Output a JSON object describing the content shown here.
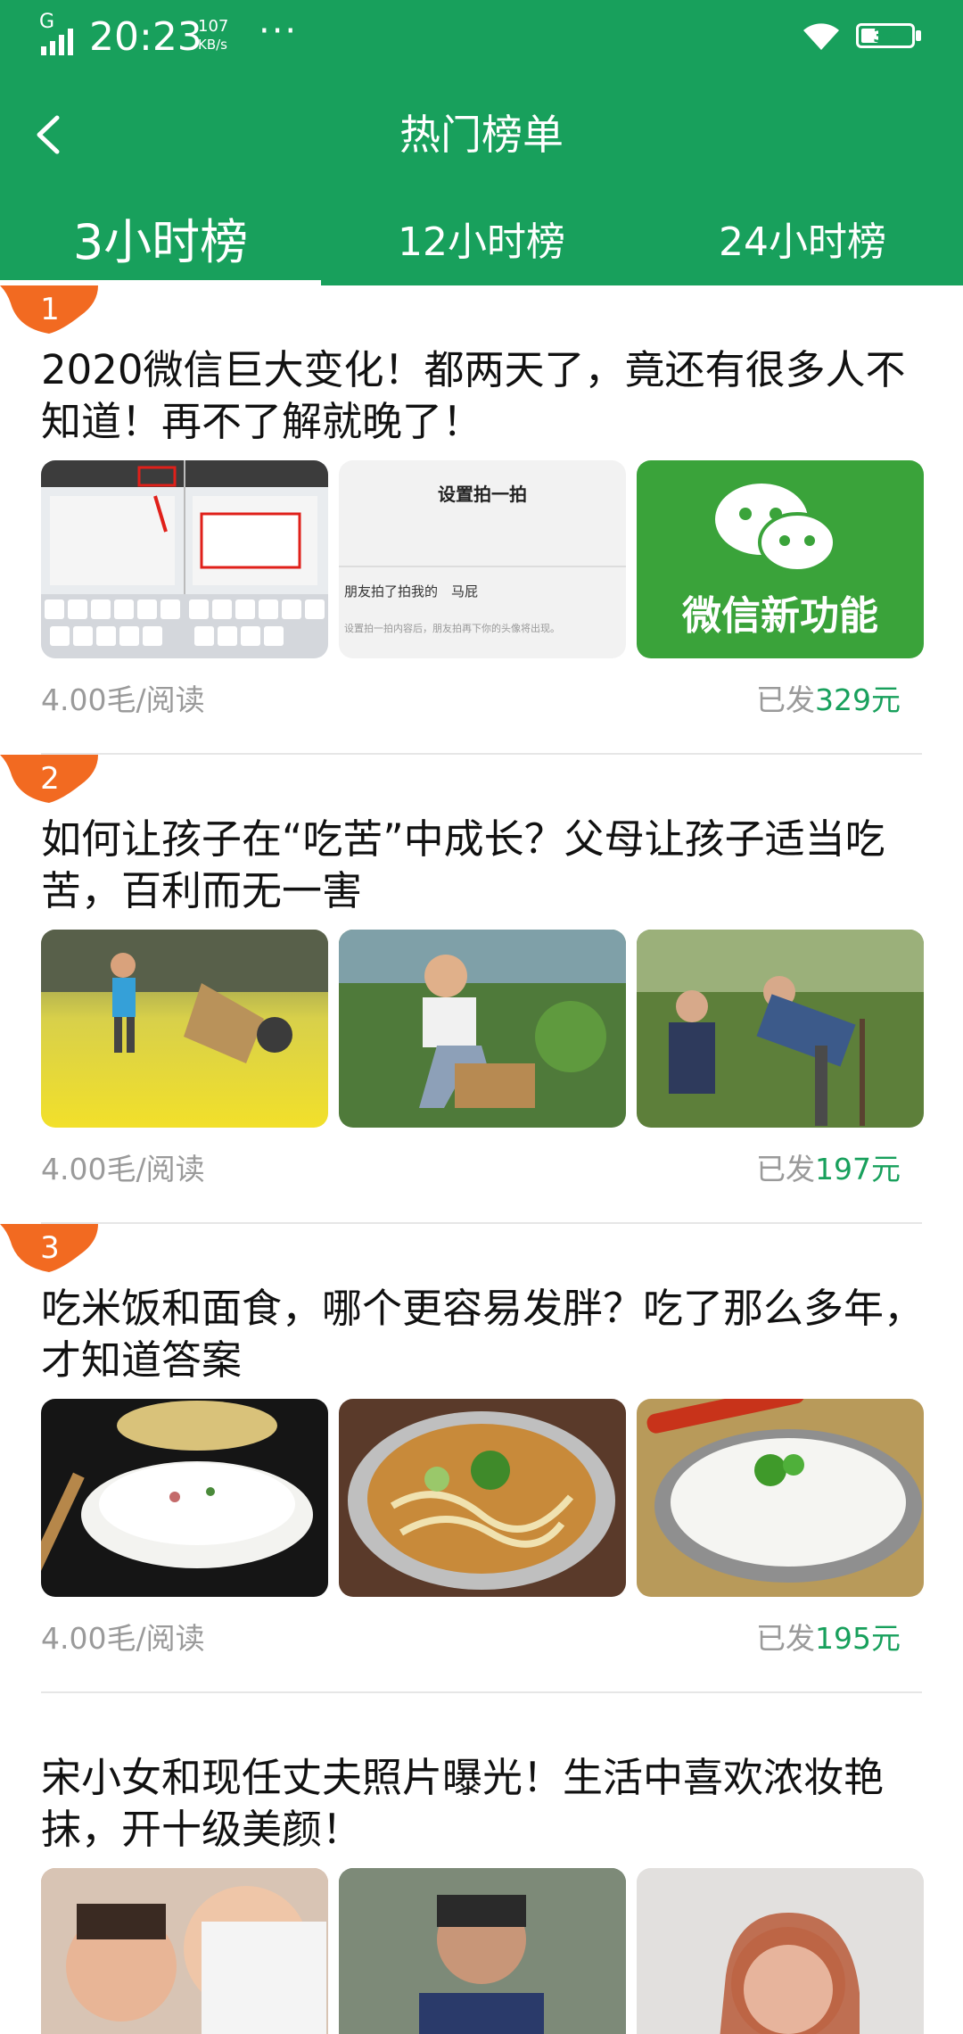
{
  "status_bar": {
    "signal_label": "G",
    "time": "20:23",
    "speed_value": "107",
    "speed_unit": "KB/s",
    "more": "···",
    "battery": "36",
    "battery_level": 0.36
  },
  "header": {
    "title": "热门榜单"
  },
  "tabs": [
    {
      "label": "3小时榜",
      "active": true
    },
    {
      "label": "12小时榜",
      "active": false
    },
    {
      "label": "24小时榜",
      "active": false
    }
  ],
  "articles": [
    {
      "rank": "1",
      "title": "2020微信巨大变化！都两天了，竟还有很多人不知道！再不了解就晚了！",
      "price": "4.00毛/阅读",
      "paid_prefix": "已发",
      "paid_amount": "329元",
      "thumbs": [
        {
          "icon": "keyboard-screenshot-image",
          "caption": ""
        },
        {
          "icon": "settings-screenshot-image",
          "caption": "设置拍一拍",
          "lines": [
            "朋友拍了拍我的　马屁",
            "设置拍一拍内容后，朋友拍再下你的头像将出现。"
          ]
        },
        {
          "icon": "wechat-logo-image",
          "caption": "微信新功能"
        }
      ]
    },
    {
      "rank": "2",
      "title": "如何让孩子在“吃苦”中成长？父母让孩子适当吃苦，百利而无一害",
      "price": "4.00毛/阅读",
      "paid_prefix": "已发",
      "paid_amount": "197元",
      "thumbs": [
        {
          "icon": "child-field-image"
        },
        {
          "icon": "boy-sitting-image"
        },
        {
          "icon": "farmers-image"
        }
      ]
    },
    {
      "rank": "3",
      "title": "吃米饭和面食，哪个更容易发胖？吃了那么多年，才知道答案",
      "price": "4.00毛/阅读",
      "paid_prefix": "已发",
      "paid_amount": "195元",
      "thumbs": [
        {
          "icon": "rice-bowl-image"
        },
        {
          "icon": "noodle-bowl-image"
        },
        {
          "icon": "rice-plate-image"
        }
      ]
    },
    {
      "rank": "",
      "title": "宋小女和现任丈夫照片曝光！生活中喜欢浓妆艳抹，开十级美颜！",
      "thumbs": [
        {
          "icon": "couple-photo-image"
        },
        {
          "icon": "woman-smiling-image"
        },
        {
          "icon": "woman-selfie-image"
        }
      ]
    }
  ],
  "colors": {
    "brand": "#18a05c",
    "rank_badge": "#f26a21"
  }
}
